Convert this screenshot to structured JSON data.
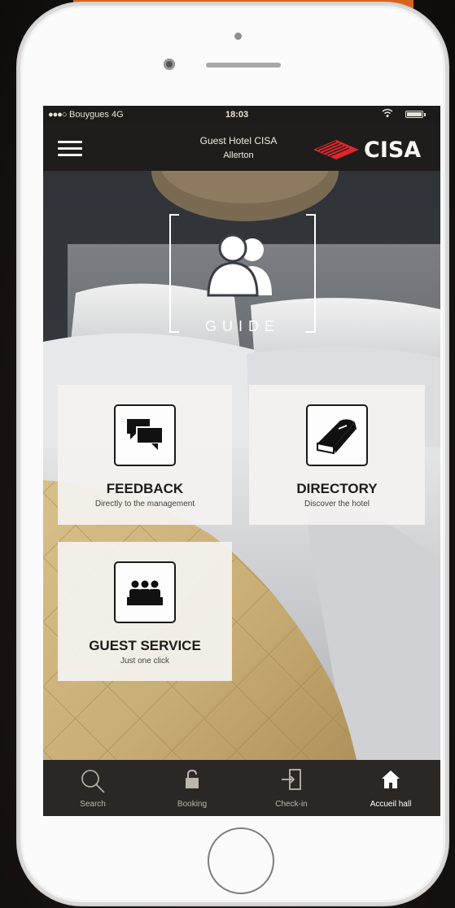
{
  "status_bar": {
    "signal": "●●●○ ",
    "carrier": "Bouygues 4G",
    "time": "18:03",
    "wifi": "⚬"
  },
  "header": {
    "hotel_name": "Guest Hotel CISA",
    "city": "Allerton",
    "logo_text": "CISA",
    "logo_color": "#e0262b"
  },
  "guide": {
    "label": "GUIDE"
  },
  "tiles": [
    {
      "title": "FEEDBACK",
      "subtitle": "Directly to the management",
      "icon": "chat-bubbles-icon"
    },
    {
      "title": "DIRECTORY",
      "subtitle": "Discover the hotel",
      "icon": "book-icon"
    },
    {
      "title": "GUEST SERVICE",
      "subtitle": "Just one click",
      "icon": "service-team-icon"
    }
  ],
  "tab_bar": [
    {
      "label": "Search",
      "icon": "search-icon",
      "active": false
    },
    {
      "label": "Booking",
      "icon": "lock-icon",
      "active": false
    },
    {
      "label": "Check-in",
      "icon": "door-enter-icon",
      "active": false
    },
    {
      "label": "Accueil hall",
      "icon": "home-icon",
      "active": true
    }
  ],
  "colors": {
    "accent_orange": "#d7631f",
    "header_dark": "#1f1d1b",
    "tab_bar": "#2b2724"
  }
}
